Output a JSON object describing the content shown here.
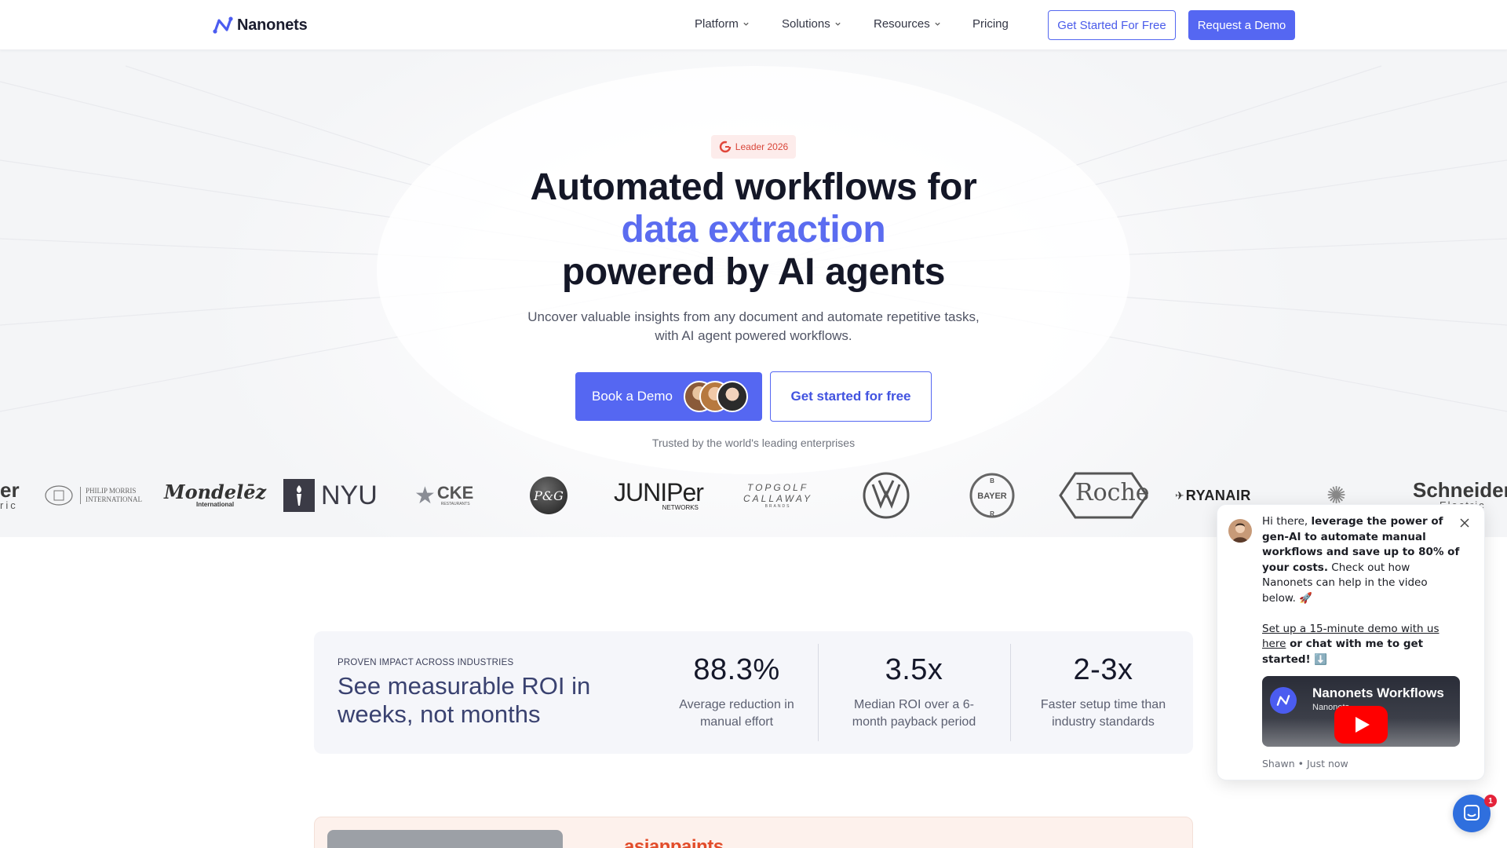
{
  "nav": {
    "brand": "Nanonets",
    "items": [
      {
        "label": "Platform",
        "has_menu": true
      },
      {
        "label": "Solutions",
        "has_menu": true
      },
      {
        "label": "Resources",
        "has_menu": true
      },
      {
        "label": "Pricing",
        "has_menu": false
      }
    ],
    "cta_outline": "Get Started For Free",
    "cta_solid": "Request a Demo"
  },
  "hero": {
    "badge": "Leader 2026",
    "title_line1": "Automated workflows for",
    "title_accent": "data extraction",
    "title_line3": "powered by AI agents",
    "subtitle_line1": "Uncover valuable insights from any document and automate repetitive tasks,",
    "subtitle_line2": "with AI agent powered workflows.",
    "primary_button": "Book a Demo",
    "secondary_button": "Get started for free",
    "trusted_text": "Trusted by the world's leading enterprises"
  },
  "brands": {
    "schneider_partial": "er",
    "schneider_partial_sub": "ric",
    "philip_morris_line1": "PHILIP MORRIS",
    "philip_morris_line2": "INTERNATIONAL",
    "mondelez": "Mondelēz",
    "mondelez_sub": "International",
    "nyu": "NYU",
    "cke": "CKE",
    "cke_sub": "RESTAURANTS",
    "pg": "P&G",
    "juniper": "JUNIPer",
    "juniper_sub": "NETWORKS",
    "topgolf_line1": "TOPGOLF",
    "topgolf_line2": "CALLAWAY",
    "topgolf_line3": "BRANDS",
    "vw": "VW",
    "bayer": "BAYER",
    "roche": "Roche",
    "ryanair": "RYANAIR",
    "schneider": "Schneider",
    "schneider_sub": "Electric"
  },
  "roi": {
    "eyebrow": "PROVEN IMPACT ACROSS INDUSTRIES",
    "heading": "See measurable ROI in weeks, not months",
    "stats": [
      {
        "value": "88.3%",
        "label": "Average reduction in manual effort"
      },
      {
        "value": "3.5x",
        "label": "Median ROI over a 6-month payback period"
      },
      {
        "value": "2-3x",
        "label": "Faster setup time than industry standards"
      }
    ]
  },
  "case_study": {
    "brand": "asianpaints"
  },
  "chat": {
    "greeting": "Hi there, ",
    "bold_1": "leverage the power of gen-AI to automate manual workflows and save up to 80% of your costs.",
    "text_1": " Check out how Nanonets can help in the video below. 🚀",
    "link_1": "Set up a 15-minute demo with us",
    "link_2": "here",
    "bold_2": " or chat with me to get started! ⬇️",
    "video_title": "Nanonets Workflows",
    "video_channel": "Nanonets",
    "meta": "Shawn • Just now",
    "unread_count": "1"
  },
  "colors": {
    "accent": "#5567f2",
    "title_accent": "#5b6cf0",
    "badge_text": "#d9463a",
    "launcher": "#2f6fde"
  }
}
